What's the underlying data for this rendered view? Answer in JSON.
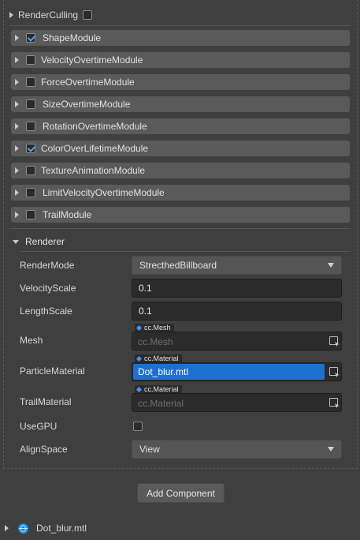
{
  "render_culling": {
    "label": "RenderCulling",
    "checked": false
  },
  "modules": [
    {
      "label": "ShapeModule",
      "checked": true
    },
    {
      "label": "VelocityOvertimeModule",
      "checked": false
    },
    {
      "label": "ForceOvertimeModule",
      "checked": false
    },
    {
      "label": "SizeOvertimeModule",
      "checked": false
    },
    {
      "label": "RotationOvertimeModule",
      "checked": false
    },
    {
      "label": "ColorOverLifetimeModule",
      "checked": true
    },
    {
      "label": "TextureAnimationModule",
      "checked": false
    },
    {
      "label": "LimitVelocityOvertimeModule",
      "checked": false
    },
    {
      "label": "TrailModule",
      "checked": false
    }
  ],
  "renderer": {
    "header": "Renderer",
    "render_mode": {
      "label": "RenderMode",
      "value": "StrecthedBillboard"
    },
    "velocity_scale": {
      "label": "VelocityScale",
      "value": "0.1"
    },
    "length_scale": {
      "label": "LengthScale",
      "value": "0.1"
    },
    "mesh": {
      "label": "Mesh",
      "type_tag": "cc.Mesh",
      "placeholder": "cc.Mesh"
    },
    "particle_material": {
      "label": "ParticleMaterial",
      "type_tag": "cc.Material",
      "value": "Dot_blur.mtl"
    },
    "trail_material": {
      "label": "TrailMaterial",
      "type_tag": "cc.Material",
      "placeholder": "cc.Material"
    },
    "use_gpu": {
      "label": "UseGPU",
      "checked": false
    },
    "align_space": {
      "label": "AlignSpace",
      "value": "View"
    }
  },
  "add_component_label": "Add Component",
  "asset_entry": {
    "label": "Dot_blur.mtl"
  },
  "colors": {
    "background": "#3f3f3f",
    "module_bar": "#5a5a5a",
    "selected": "#1f6fd1",
    "checkmark": "#4aa3ff"
  }
}
